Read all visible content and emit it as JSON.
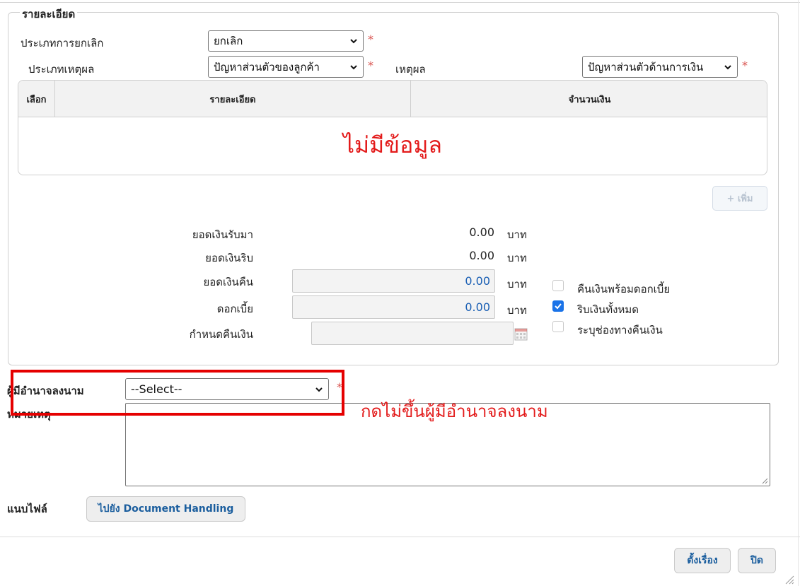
{
  "section": {
    "legend": "รายละเอียด"
  },
  "cancel_type": {
    "label": "ประเภทการยกเลิก",
    "value": "ยกเลิก"
  },
  "reason_type": {
    "label": "ประเภทเหตุผล",
    "value": "ปัญหาส่วนตัวของลูกค้า"
  },
  "reason": {
    "label": "เหตุผล",
    "value": "ปัญหาส่วนตัวด้านการเงิน"
  },
  "required_mark": "*",
  "table": {
    "columns": [
      "เลือก",
      "รายละเอียด",
      "จำนวนเงิน"
    ],
    "empty_text": "ไม่มีข้อมูล"
  },
  "add_button": {
    "icon": "plus-icon",
    "label": "+ เพิ่ม"
  },
  "amounts": {
    "unit": "บาท",
    "received": {
      "label": "ยอดเงินรับมา",
      "value": "0.00"
    },
    "forfeited": {
      "label": "ยอดเงินริบ",
      "value": "0.00"
    },
    "refund": {
      "label": "ยอดเงินคืน",
      "value": "0.00"
    },
    "interest": {
      "label": "ดอกเบี้ย",
      "value": "0.00"
    },
    "refund_date": {
      "label": "กำหนดคืนเงิน",
      "value": ""
    }
  },
  "options": [
    {
      "label": "คืนเงินพร้อมดอกเบี้ย",
      "checked": false
    },
    {
      "label": "ริบเงินทั้งหมด",
      "checked": true
    },
    {
      "label": "ระบุช่องทางคืนเงิน",
      "checked": false
    }
  ],
  "signer": {
    "label": "ผู้มีอำนาจลงนาม",
    "value": "--Select--"
  },
  "remark": {
    "label": "หมายเหตุ",
    "value": ""
  },
  "annotation": "กดไม่ขึ้นผู้มีอำนาจลงนาม",
  "attach": {
    "label": "แนบไฟล์",
    "button": "ไปยัง Document Handling"
  },
  "footer": {
    "submit": "ตั้งเรื่อง",
    "close": "ปิด"
  },
  "colors": {
    "annotation": "#e31b1b",
    "link_blue": "#1b5e9e",
    "checkbox_on": "#1a73e8",
    "required": "#d9534f"
  }
}
